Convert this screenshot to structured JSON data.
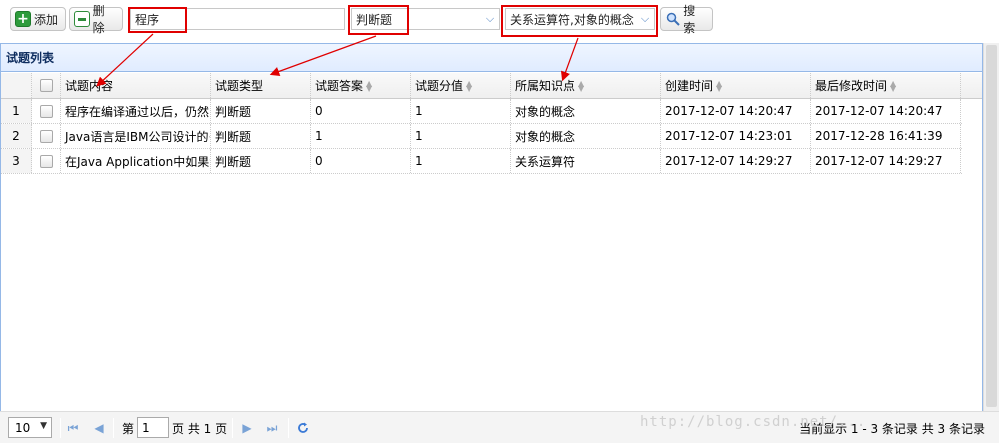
{
  "toolbar": {
    "add_label": "添加",
    "delete_label": "删除",
    "search_label": "搜索",
    "keyword_value": "程序",
    "type_value": "判断题",
    "knowledge_value": "关系运算符,对象的概念"
  },
  "panel": {
    "title": "试题列表"
  },
  "columns": [
    {
      "label": "试题内容"
    },
    {
      "label": "试题类型"
    },
    {
      "label": "试题答案"
    },
    {
      "label": "试题分值"
    },
    {
      "label": "所属知识点"
    },
    {
      "label": "创建时间"
    },
    {
      "label": "最后修改时间"
    }
  ],
  "rows": [
    {
      "num": "1",
      "content": "程序在编译通过以后，仍然",
      "type": "判断题",
      "answer": "0",
      "score": "1",
      "knowledge": "对象的概念",
      "created": "2017-12-07 14:20:47",
      "modified": "2017-12-07 14:20:47"
    },
    {
      "num": "2",
      "content": "Java语言是IBM公司设计的·",
      "type": "判断题",
      "answer": "1",
      "score": "1",
      "knowledge": "对象的概念",
      "created": "2017-12-07 14:23:01",
      "modified": "2017-12-28 16:41:39"
    },
    {
      "num": "3",
      "content": "在Java Application中如果没",
      "type": "判断题",
      "answer": "0",
      "score": "1",
      "knowledge": "关系运算符",
      "created": "2017-12-07 14:29:27",
      "modified": "2017-12-07 14:29:27"
    }
  ],
  "pager": {
    "page_size": "10",
    "page_prefix": "第",
    "page_number": "1",
    "page_suffix": "页 共 1 页",
    "info": "当前显示 1 - 3 条记录 共 3 条记录"
  },
  "watermark": "http://blog.csdn.net/...",
  "colors": {
    "annotation_red": "#e00000",
    "panel_border": "#95b8e7",
    "add_icon": "#2e9b3c"
  }
}
